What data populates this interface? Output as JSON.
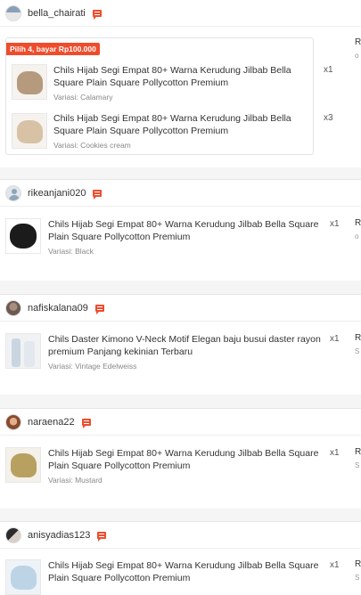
{
  "orders": [
    {
      "username": "bella_chairati",
      "promo": "Pilih 4, bayar Rp100.000",
      "items": [
        {
          "name": "Chils Hijab Segi Empat 80+ Warna Kerudung Jilbab Bella Square Plain Square Pollycotton Premium",
          "variant": "Variasi: Calamary",
          "qty": "x1"
        },
        {
          "name": "Chils Hijab Segi Empat 80+ Warna Kerudung Jilbab Bella Square Plain Square Pollycotton Premium",
          "variant": "Variasi: Cookies cream",
          "qty": "x3"
        }
      ],
      "side": "R",
      "side_sub": "o"
    },
    {
      "username": "rikeanjani020",
      "items": [
        {
          "name": "Chils Hijab Segi Empat 80+ Warna Kerudung Jilbab Bella Square Plain Square Pollycotton Premium",
          "variant": "Variasi: Black",
          "qty": "x1"
        }
      ],
      "side": "R",
      "side_sub": "o"
    },
    {
      "username": "nafiskalana09",
      "items": [
        {
          "name": "Chils Daster Kimono V-Neck Motif Elegan baju busui daster rayon premium Panjang kekinian Terbaru",
          "variant": "Variasi: Vintage Edelweiss",
          "qty": "x1"
        }
      ],
      "side": "R",
      "side_sub": "S"
    },
    {
      "username": "naraena22",
      "items": [
        {
          "name": "Chils Hijab Segi Empat 80+ Warna Kerudung Jilbab Bella Square Plain Square Pollycotton Premium",
          "variant": "Variasi: Mustard",
          "qty": "x1"
        }
      ],
      "side": "R",
      "side_sub": "S"
    },
    {
      "username": "anisyadias123",
      "items": [
        {
          "name": "Chils Hijab Segi Empat 80+ Warna Kerudung Jilbab Bella Square Plain Square Pollycotton Premium",
          "variant": "",
          "qty": "x1"
        }
      ],
      "side": "R",
      "side_sub": "S"
    }
  ],
  "colors": {
    "accent": "#ee4d2d",
    "calamary": "#b59a7e",
    "cookies": "#d8c2a6",
    "black": "#1b1b1b",
    "mustard": "#b8a060",
    "light_blue": "#bcd4e6"
  }
}
